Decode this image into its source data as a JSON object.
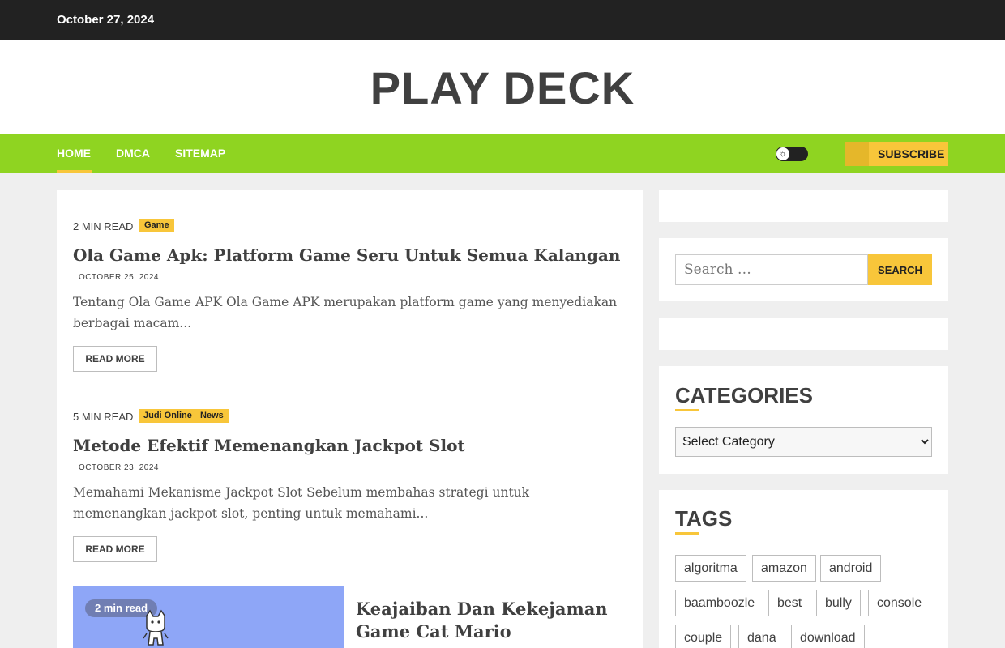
{
  "topbar": {
    "date": "October 27, 2024"
  },
  "site": {
    "title": "PLAY DECK"
  },
  "nav": {
    "items": [
      "HOME",
      "DMCA",
      "SITEMAP"
    ],
    "theme_toggle_icon": "sun-icon",
    "subscribe_label": "SUBSCRIBE",
    "accent_color": "#8fd421",
    "highlight_color": "#f8c63a"
  },
  "posts": [
    {
      "read_time": "2 MIN READ",
      "categories": [
        "Game"
      ],
      "title": "Ola Game Apk: Platform Game Seru Untuk Semua Kalangan",
      "date": "OCTOBER 25, 2024",
      "excerpt": "Tentang Ola Game APK Ola Game APK merupakan platform game yang menyediakan berbagai macam...",
      "read_more": "READ MORE"
    },
    {
      "read_time": "5 MIN READ",
      "categories": [
        "Judi Online",
        "News"
      ],
      "title": "Metode Efektif Memenangkan Jackpot Slot",
      "date": "OCTOBER 23, 2024",
      "excerpt": "Memahami Mekanisme Jackpot Slot Sebelum membahas strategi untuk memenangkan jackpot slot, penting untuk memahami...",
      "read_more": "READ MORE"
    }
  ],
  "featured": {
    "read_time": "2 min read",
    "title": "Keajaiban Dan Kekejaman Game Cat Mario",
    "image_icon": "cat-icon"
  },
  "sidebar": {
    "search": {
      "placeholder": "Search …",
      "button": "SEARCH"
    },
    "categories": {
      "heading": "CATEGORIES",
      "selected": "Select Category"
    },
    "tags": {
      "heading": "TAGS",
      "items": [
        "algoritma",
        "amazon",
        "android",
        "baamboozle",
        "best",
        "bully",
        "console",
        "couple",
        "dana",
        "download"
      ]
    }
  }
}
